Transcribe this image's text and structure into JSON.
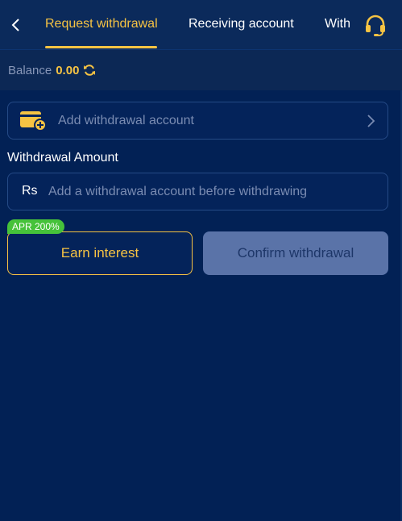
{
  "nav": {
    "tabs": [
      {
        "label": "Request withdrawal",
        "active": true
      },
      {
        "label": "Receiving account",
        "active": false
      },
      {
        "label": "With",
        "active": false
      }
    ],
    "back_icon": "chevron-left-icon",
    "support_icon": "headset-icon"
  },
  "balance": {
    "label": "Balance",
    "value": "0.00",
    "refresh_icon": "refresh-icon"
  },
  "account": {
    "add_label": "Add withdrawal account",
    "icon": "wallet-add-icon"
  },
  "amount": {
    "label": "Withdrawal Amount",
    "currency": "Rs",
    "placeholder": "Add a withdrawal account before withdrawing",
    "value": ""
  },
  "actions": {
    "apr_badge": "APR 200%",
    "earn_label": "Earn interest",
    "confirm_label": "Confirm withdrawal"
  },
  "colors": {
    "background": "#022155",
    "accent": "#f6c343",
    "badge": "#46c23a",
    "disabled_button": "#5a73a8"
  }
}
